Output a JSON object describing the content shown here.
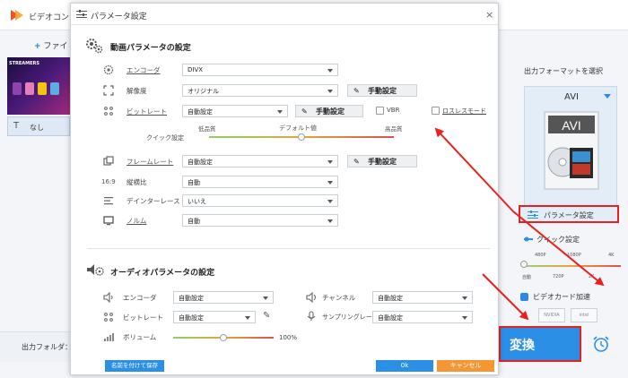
{
  "app": {
    "title": "ビデオコン",
    "toolbar": {
      "add_file": "ファイ"
    },
    "thumbnail_label": "STREAMERS",
    "subtitle": {
      "icon": "T",
      "value": "なし"
    },
    "output_folder_label": "出力フォルダ："
  },
  "right_panel": {
    "format_heading": "出力フォーマットを選択",
    "format_name": "AVI",
    "format_icon_text": "AVI",
    "param_button": "パラメータ設定",
    "quick_setting": {
      "label": "クイック設定",
      "top_labels": [
        "480P",
        "1080P",
        "4K"
      ],
      "bottom_labels": [
        "自動",
        "720P",
        "2K"
      ]
    },
    "gpu": {
      "label": "ビデオカード加速",
      "badges": [
        "NVIDIA",
        "intel"
      ]
    },
    "convert_button": "変換"
  },
  "dialog": {
    "title": "パラメータ設定",
    "close": "×",
    "video_section": {
      "title": "動画パラメータの設定",
      "rows": {
        "encoder": {
          "label": "エンコーダ",
          "value": "DIVX"
        },
        "resolution": {
          "label": "解像度",
          "value": "オリジナル",
          "button": "手動設定"
        },
        "bitrate": {
          "label": "ビットレート",
          "value": "自動設定",
          "button": "手動設定",
          "vbr": "VBR",
          "lossless": "ロスレスモード"
        },
        "quick": {
          "label": "クイック設定",
          "low": "低品質",
          "default": "デフォルト値",
          "high": "高品質",
          "level": 0.5
        },
        "framerate": {
          "label": "フレームレート",
          "value": "自動設定",
          "button": "手動設定"
        },
        "aspect": {
          "label": "縦横比",
          "value": "自動"
        },
        "deinterlace": {
          "label": "デインターレース",
          "value": "いいえ"
        },
        "norm": {
          "label": "ノルム",
          "value": "自動"
        }
      }
    },
    "audio_section": {
      "title": "オーディオパラメータの設定",
      "rows": {
        "encoder": {
          "label": "エンコーダ",
          "value": "自動設定"
        },
        "channel": {
          "label": "チャンネル",
          "value": "自動設定"
        },
        "bitrate": {
          "label": "ビットレート",
          "value": "自動設定"
        },
        "samplerate": {
          "label": "サンプリングレート",
          "value": "自動設定"
        },
        "volume": {
          "label": "ボリューム",
          "value": "100%",
          "level": 0.5
        }
      }
    },
    "footer": {
      "save_named": "名前を付けて保存",
      "ok": "0k",
      "cancel": "キャンセル"
    }
  },
  "colors": {
    "accent_blue": "#2b8fe6",
    "cancel_orange": "#f49631",
    "annotation_red": "#e8211f"
  }
}
